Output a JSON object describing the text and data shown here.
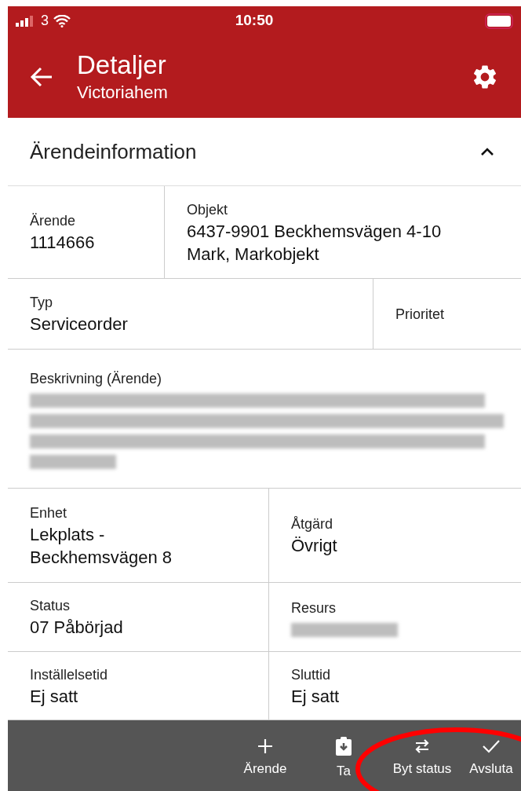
{
  "status_bar": {
    "carrier": "3",
    "time": "10:50"
  },
  "header": {
    "title": "Detaljer",
    "subtitle": "Victoriahem"
  },
  "section": {
    "title": "Ärendeinformation",
    "expanded": true
  },
  "rows": [
    {
      "cells": [
        {
          "kind": "text",
          "label": "Ärende",
          "lines": [
            "1114666"
          ]
        },
        {
          "kind": "text",
          "label": "Objekt",
          "lines": [
            "6437-9901 Beckhemsvägen 4-10",
            "Mark, Markobjekt"
          ]
        }
      ]
    },
    {
      "cells": [
        {
          "kind": "text",
          "label": "Typ",
          "lines": [
            "Serviceorder"
          ]
        },
        {
          "kind": "text",
          "label": "Prioritet"
        }
      ]
    },
    {
      "cells": [
        {
          "kind": "redacted",
          "label": "Beskrivning (Ärende)"
        }
      ]
    },
    {
      "cells": [
        {
          "kind": "text",
          "label": "Enhet",
          "lines": [
            "Lekplats -",
            "Beckhemsvägen 8"
          ]
        },
        {
          "kind": "text",
          "label": "Åtgärd",
          "lines": [
            "Övrigt"
          ]
        }
      ]
    },
    {
      "cells": [
        {
          "kind": "text",
          "label": "Status",
          "lines": [
            "07 Påbörjad"
          ]
        },
        {
          "kind": "redacted",
          "label": "Resurs"
        }
      ]
    },
    {
      "cells": [
        {
          "kind": "text",
          "label": "Inställelsetid",
          "lines": [
            "Ej satt"
          ]
        },
        {
          "kind": "text",
          "label": "Sluttid",
          "lines": [
            "Ej satt"
          ]
        }
      ]
    }
  ],
  "actions": [
    {
      "kind": "add",
      "label": "Ärende"
    },
    {
      "kind": "take",
      "label": "Ta"
    },
    {
      "kind": "swap",
      "label": "Byt status"
    },
    {
      "kind": "done",
      "label": "Avsluta"
    }
  ]
}
